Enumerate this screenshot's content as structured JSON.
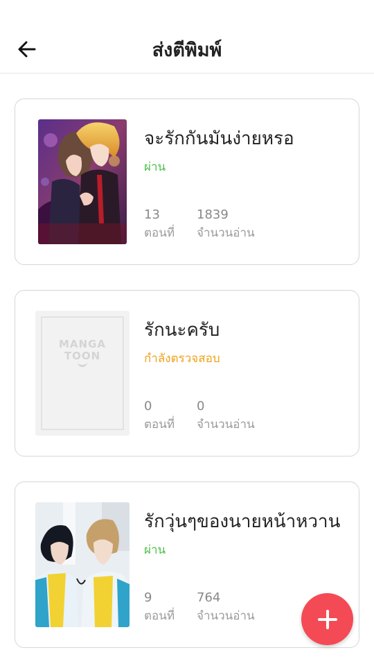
{
  "header": {
    "title": "ส่งตีพิมพ์",
    "back_icon": "arrow-left-icon"
  },
  "works": [
    {
      "title": "จะรักกันมันง่ายหรอ",
      "status": "ผ่าน",
      "status_color": "#4cc04a",
      "episodes": "13",
      "episodes_label": "ตอนที่",
      "reads": "1839",
      "reads_label": "จำนวนอ่าน",
      "cover": "anime-illustration-cover"
    },
    {
      "title": "รักนะครับ",
      "status": "กำลังตรวจสอบ",
      "status_color": "#f0a21c",
      "episodes": "0",
      "episodes_label": "ตอนที่",
      "reads": "0",
      "reads_label": "จำนวนอ่าน",
      "cover": "placeholder-cover",
      "placeholder_logo": "MANGA TOON"
    },
    {
      "title": "รักวุ่นๆของนายหน้าหวาน",
      "status": "ผ่าน",
      "status_color": "#4cc04a",
      "episodes": "9",
      "episodes_label": "ตอนที่",
      "reads": "764",
      "reads_label": "จำนวนอ่าน",
      "cover": "cosplay-photo-cover"
    }
  ],
  "fab": {
    "icon": "plus-icon",
    "color": "#f44a55"
  }
}
